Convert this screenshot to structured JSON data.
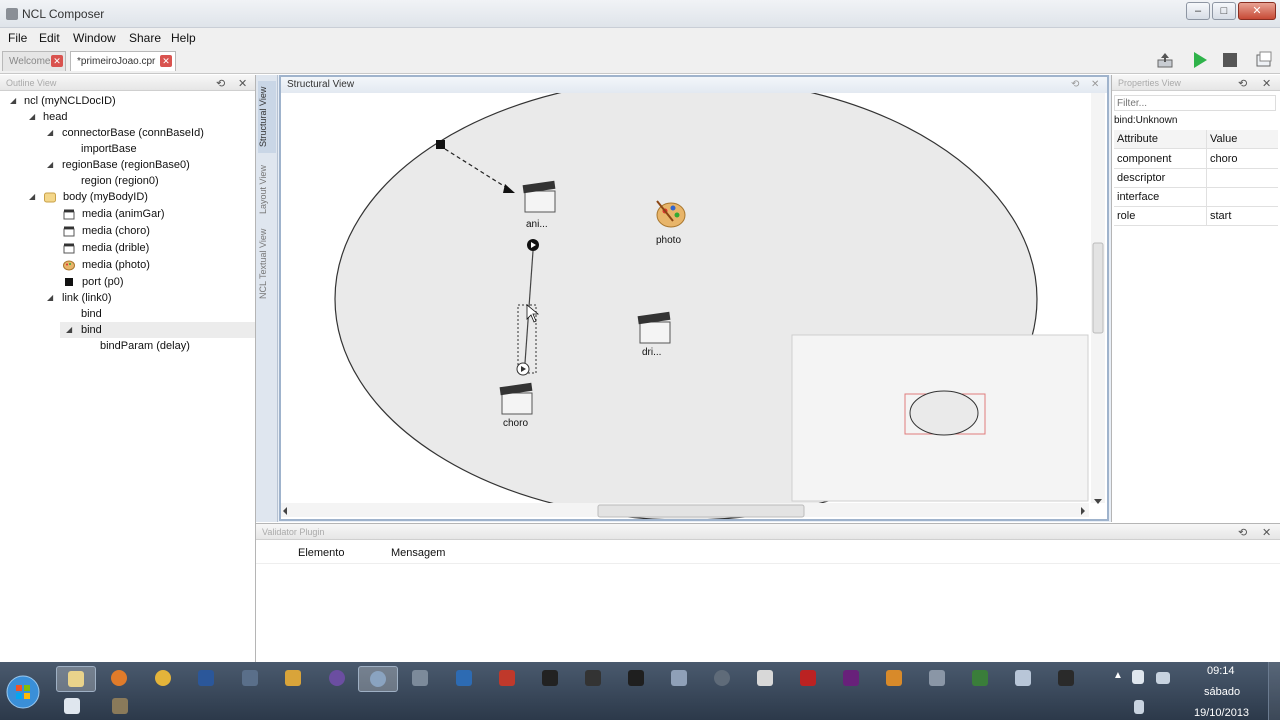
{
  "window": {
    "title": "NCL Composer"
  },
  "menu": [
    "File",
    "Edit",
    "Window",
    "Share",
    "Help"
  ],
  "tabs": [
    {
      "label": "Welcome"
    },
    {
      "label": "*primeiroJoao.cpr"
    }
  ],
  "outline": {
    "title": "Outline View",
    "tree": [
      {
        "label": "ncl (myNCLDocID)"
      },
      {
        "label": "head"
      },
      {
        "label": "connectorBase (connBaseId)"
      },
      {
        "label": "importBase"
      },
      {
        "label": "regionBase (regionBase0)"
      },
      {
        "label": "region (region0)"
      },
      {
        "label": "body (myBodyID)"
      },
      {
        "label": "media (animGar)"
      },
      {
        "label": "media (choro)"
      },
      {
        "label": "media (drible)"
      },
      {
        "label": "media (photo)"
      },
      {
        "label": "port (p0)"
      },
      {
        "label": "link (link0)"
      },
      {
        "label": "bind"
      },
      {
        "label": "bind"
      },
      {
        "label": "bindParam (delay)"
      }
    ]
  },
  "side_tabs": [
    "Structural View",
    "Layout View",
    "NCL Textual View"
  ],
  "structural": {
    "title": "Structural View",
    "nodes": {
      "anim": "ani...",
      "photo": "photo",
      "dri": "dri...",
      "choro": "choro"
    }
  },
  "properties": {
    "title": "Properties View",
    "filter_placeholder": "Filter...",
    "subtitle": "bind:Unknown",
    "header": {
      "attribute": "Attribute",
      "value": "Value"
    },
    "rows": [
      {
        "attribute": "component",
        "value": "choro"
      },
      {
        "attribute": "descriptor",
        "value": ""
      },
      {
        "attribute": "interface",
        "value": ""
      },
      {
        "attribute": "role",
        "value": "start"
      }
    ]
  },
  "validator": {
    "title": "Validator Plugin",
    "columns": [
      "Elemento",
      "Mensagem"
    ]
  },
  "taskbar": {
    "time": "09:14",
    "day": "sábado",
    "date": "19/10/2013"
  },
  "colors": {
    "accent_play": "#2fb34a",
    "stop": "#555555",
    "close_red": "#c74a36",
    "taskbar": "#34435a"
  }
}
